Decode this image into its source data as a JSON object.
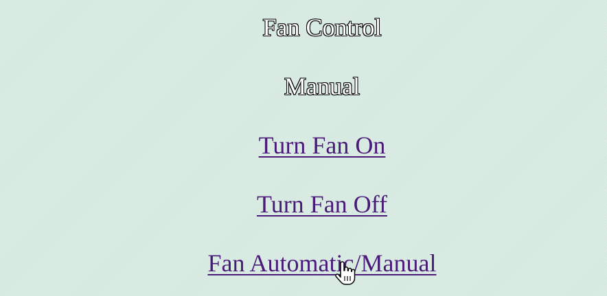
{
  "header": {
    "title": "Fan Control",
    "mode_label": "Manual"
  },
  "actions": {
    "turn_on_label": "Turn Fan On",
    "turn_off_label": "Turn Fan Off",
    "toggle_mode_label": "Fan Automatic/Manual"
  },
  "colors": {
    "background": "#d6e9e1",
    "link": "#4a1a78",
    "heading_fill": "#ffffff",
    "heading_outline": "#000000"
  },
  "cursor": {
    "icon": "hand-pointer-icon"
  }
}
